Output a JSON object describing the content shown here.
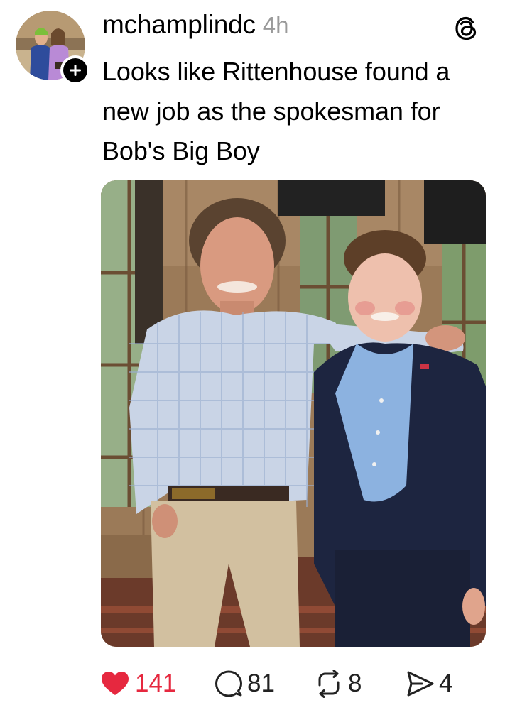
{
  "post": {
    "username": "mchamplindc",
    "timestamp": "4h",
    "text": "Looks like Rittenhouse found a new job as the spokesman for Bob's Big Boy"
  },
  "icons": {
    "app_logo": "threads-logo-icon",
    "follow": "plus-icon",
    "like": "heart-icon",
    "comment": "speech-bubble-icon",
    "repost": "repost-icon",
    "share": "send-icon"
  },
  "actions": {
    "likes": "141",
    "comments": "81",
    "reposts": "8",
    "shares": "4"
  },
  "colors": {
    "like_red": "#e6283f",
    "timestamp_gray": "#9a9a9a",
    "text": "#000000"
  }
}
